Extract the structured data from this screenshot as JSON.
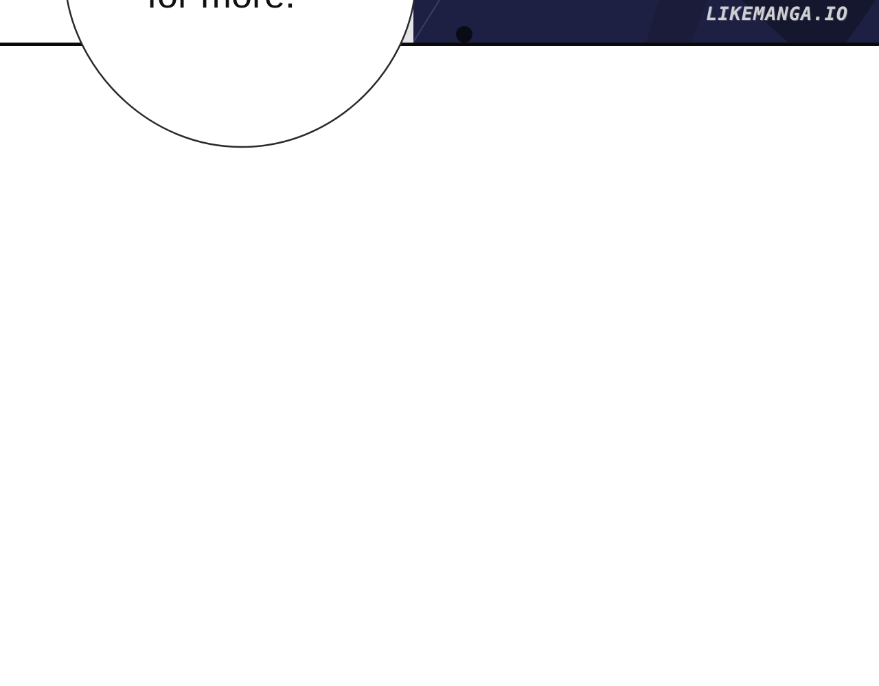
{
  "panel": {
    "speech_text": "for more.",
    "watermark": "LIKEMANGA.IO"
  },
  "colors": {
    "background": "#ffffff",
    "night_panel": "#22254a",
    "panel_border": "#0a0a0a",
    "bubble_outline": "#2a2a2a",
    "bubble_fill": "#ffffff",
    "bubble_shade": "#e4e4e6"
  }
}
